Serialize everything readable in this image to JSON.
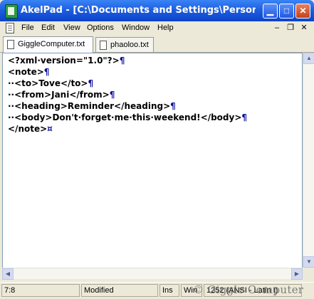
{
  "window": {
    "title": "AkelPad - [C:\\Documents and Settings\\Personal\\Desk..."
  },
  "menu": [
    "File",
    "Edit",
    "View",
    "Options",
    "Window",
    "Help"
  ],
  "tabs": [
    {
      "label": "GiggleComputer.txt",
      "active": true
    },
    {
      "label": "phaoloo.txt",
      "active": false
    }
  ],
  "editor": {
    "lines": [
      {
        "text": "<?xml·version=\"1.0\"?>",
        "mark": "¶"
      },
      {
        "text": "<note>",
        "mark": "¶"
      },
      {
        "text": "··<to>Tove</to>",
        "mark": "¶"
      },
      {
        "text": "··<from>Jani</from>",
        "mark": "¶"
      },
      {
        "text": "··<heading>Reminder</heading>",
        "mark": "¶"
      },
      {
        "text": "··<body>Don't·forget·me·this·weekend!</body>",
        "mark": "¶"
      },
      {
        "text": "</note>",
        "mark": "¤"
      }
    ]
  },
  "status": {
    "position": "7:8",
    "modified": "Modified",
    "insert_mode": "Ins",
    "newline": "Win",
    "encoding": "1252 (ANSI - Latin I)"
  },
  "watermark": "© Giggle Computer",
  "icons": {
    "app": "akelpad-app-icon",
    "document": "document-icon"
  }
}
